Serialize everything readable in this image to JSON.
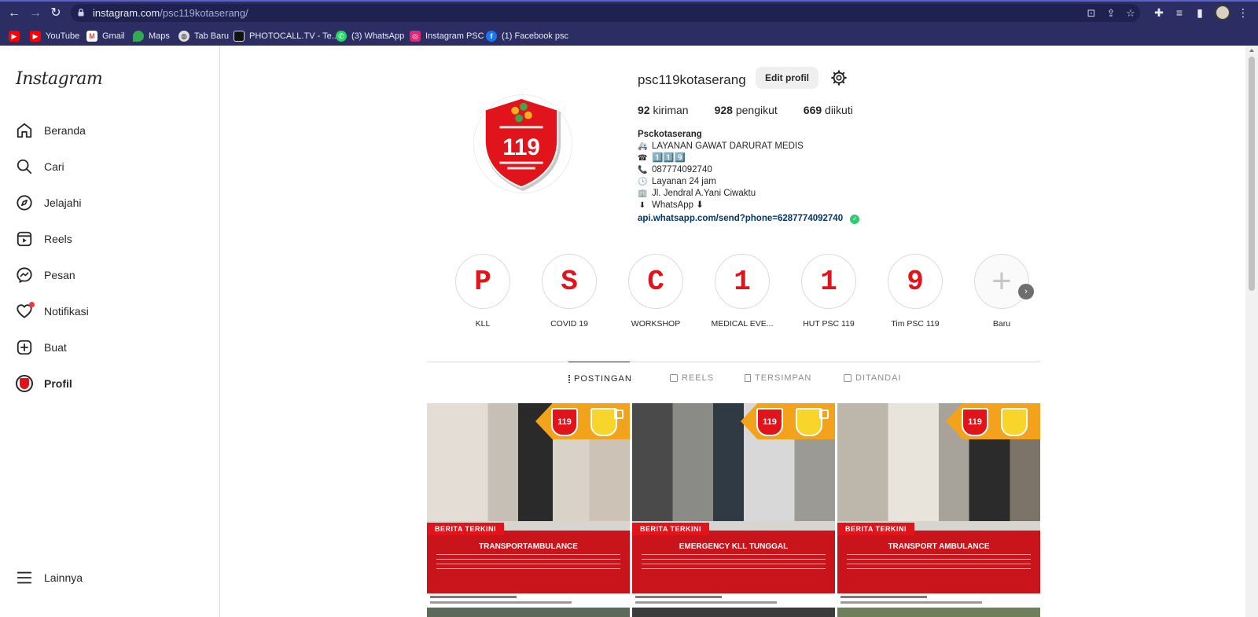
{
  "browser": {
    "url_domain": "instagram.com",
    "url_path": "/psc119kotaserang/",
    "bookmarks": [
      {
        "label": "",
        "icon": "youtube-icon",
        "color": "#ff0000"
      },
      {
        "label": "YouTube",
        "icon": "youtube-icon",
        "color": "#ff0000"
      },
      {
        "label": "Gmail",
        "icon": "gmail-icon",
        "color": "#ea4335"
      },
      {
        "label": "Maps",
        "icon": "maps-icon",
        "color": "#34a853"
      },
      {
        "label": "Tab Baru",
        "icon": "globe-icon",
        "color": "#dddddd"
      },
      {
        "label": "PHOTOCALL.TV - Te...",
        "icon": "tv-icon",
        "color": "#222222"
      },
      {
        "label": "(3) WhatsApp",
        "icon": "whatsapp-icon",
        "color": "#25d366"
      },
      {
        "label": "Instagram PSC",
        "icon": "instagram-icon",
        "color": "#d62976"
      },
      {
        "label": "(1) Facebook psc",
        "icon": "facebook-icon",
        "color": "#1877f2"
      }
    ]
  },
  "sidebar": {
    "logo": "Instagram",
    "items": [
      {
        "label": "Beranda",
        "icon": "home-icon"
      },
      {
        "label": "Cari",
        "icon": "search-icon"
      },
      {
        "label": "Jelajahi",
        "icon": "compass-icon"
      },
      {
        "label": "Reels",
        "icon": "reels-icon"
      },
      {
        "label": "Pesan",
        "icon": "messenger-icon"
      },
      {
        "label": "Notifikasi",
        "icon": "heart-icon"
      },
      {
        "label": "Buat",
        "icon": "plus-square-icon"
      },
      {
        "label": "Profil",
        "icon": "profile-avatar"
      }
    ],
    "more": "Lainnya"
  },
  "profile": {
    "username": "psc119kotaserang",
    "edit_button": "Edit profil",
    "stats": {
      "posts_count": "92",
      "posts_label": "kiriman",
      "followers_count": "928",
      "followers_label": "pengikut",
      "following_count": "669",
      "following_label": "diikuti"
    },
    "bio": {
      "name": "Psckotaserang",
      "lines": [
        {
          "emoji": "🚑",
          "text": "LAYANAN GAWAT DARURAT MEDIS"
        },
        {
          "emoji": "☎",
          "text": "1️⃣1️⃣9️⃣"
        },
        {
          "emoji": "📞",
          "text": "087774092740"
        },
        {
          "emoji": "🕓",
          "text": "Layanan 24 jam"
        },
        {
          "emoji": "🏢",
          "text": "Jl. Jendral A.Yani Ciwaktu"
        },
        {
          "emoji": "⬇",
          "text": "WhatsApp ⬇"
        }
      ],
      "link": "api.whatsapp.com/send?phone=6287774092740"
    }
  },
  "highlights": [
    {
      "glyph": "P",
      "caption": "KLL"
    },
    {
      "glyph": "S",
      "caption": "COVID 19"
    },
    {
      "glyph": "C",
      "caption": "WORKSHOP"
    },
    {
      "glyph": "1",
      "caption": "MEDICAL EVE..."
    },
    {
      "glyph": "1",
      "caption": "HUT PSC 119"
    },
    {
      "glyph": "9",
      "caption": "Tim PSC 119"
    },
    {
      "glyph": "+",
      "caption": "Baru"
    }
  ],
  "tabs": [
    {
      "label": "POSTINGAN",
      "icon": "grid-icon"
    },
    {
      "label": "REELS",
      "icon": "reels-icon"
    },
    {
      "label": "TERSIMPAN",
      "icon": "bookmark-icon"
    },
    {
      "label": "DITANDAI",
      "icon": "tagged-icon"
    }
  ],
  "posts": [
    {
      "tag": "BERITA TERKINI",
      "headline": "TRANSPORTAMBULANCE",
      "shield": "119"
    },
    {
      "tag": "BERITA TERKINI",
      "headline": "EMERGENCY KLL TUNGGAL",
      "shield": "119"
    },
    {
      "tag": "BERITA TERKINI",
      "headline": "TRANSPORT AMBULANCE",
      "shield": "119"
    }
  ],
  "colors": {
    "chrome": "#2b2d63",
    "accent_red": "#e1141b",
    "link": "#00376b"
  }
}
